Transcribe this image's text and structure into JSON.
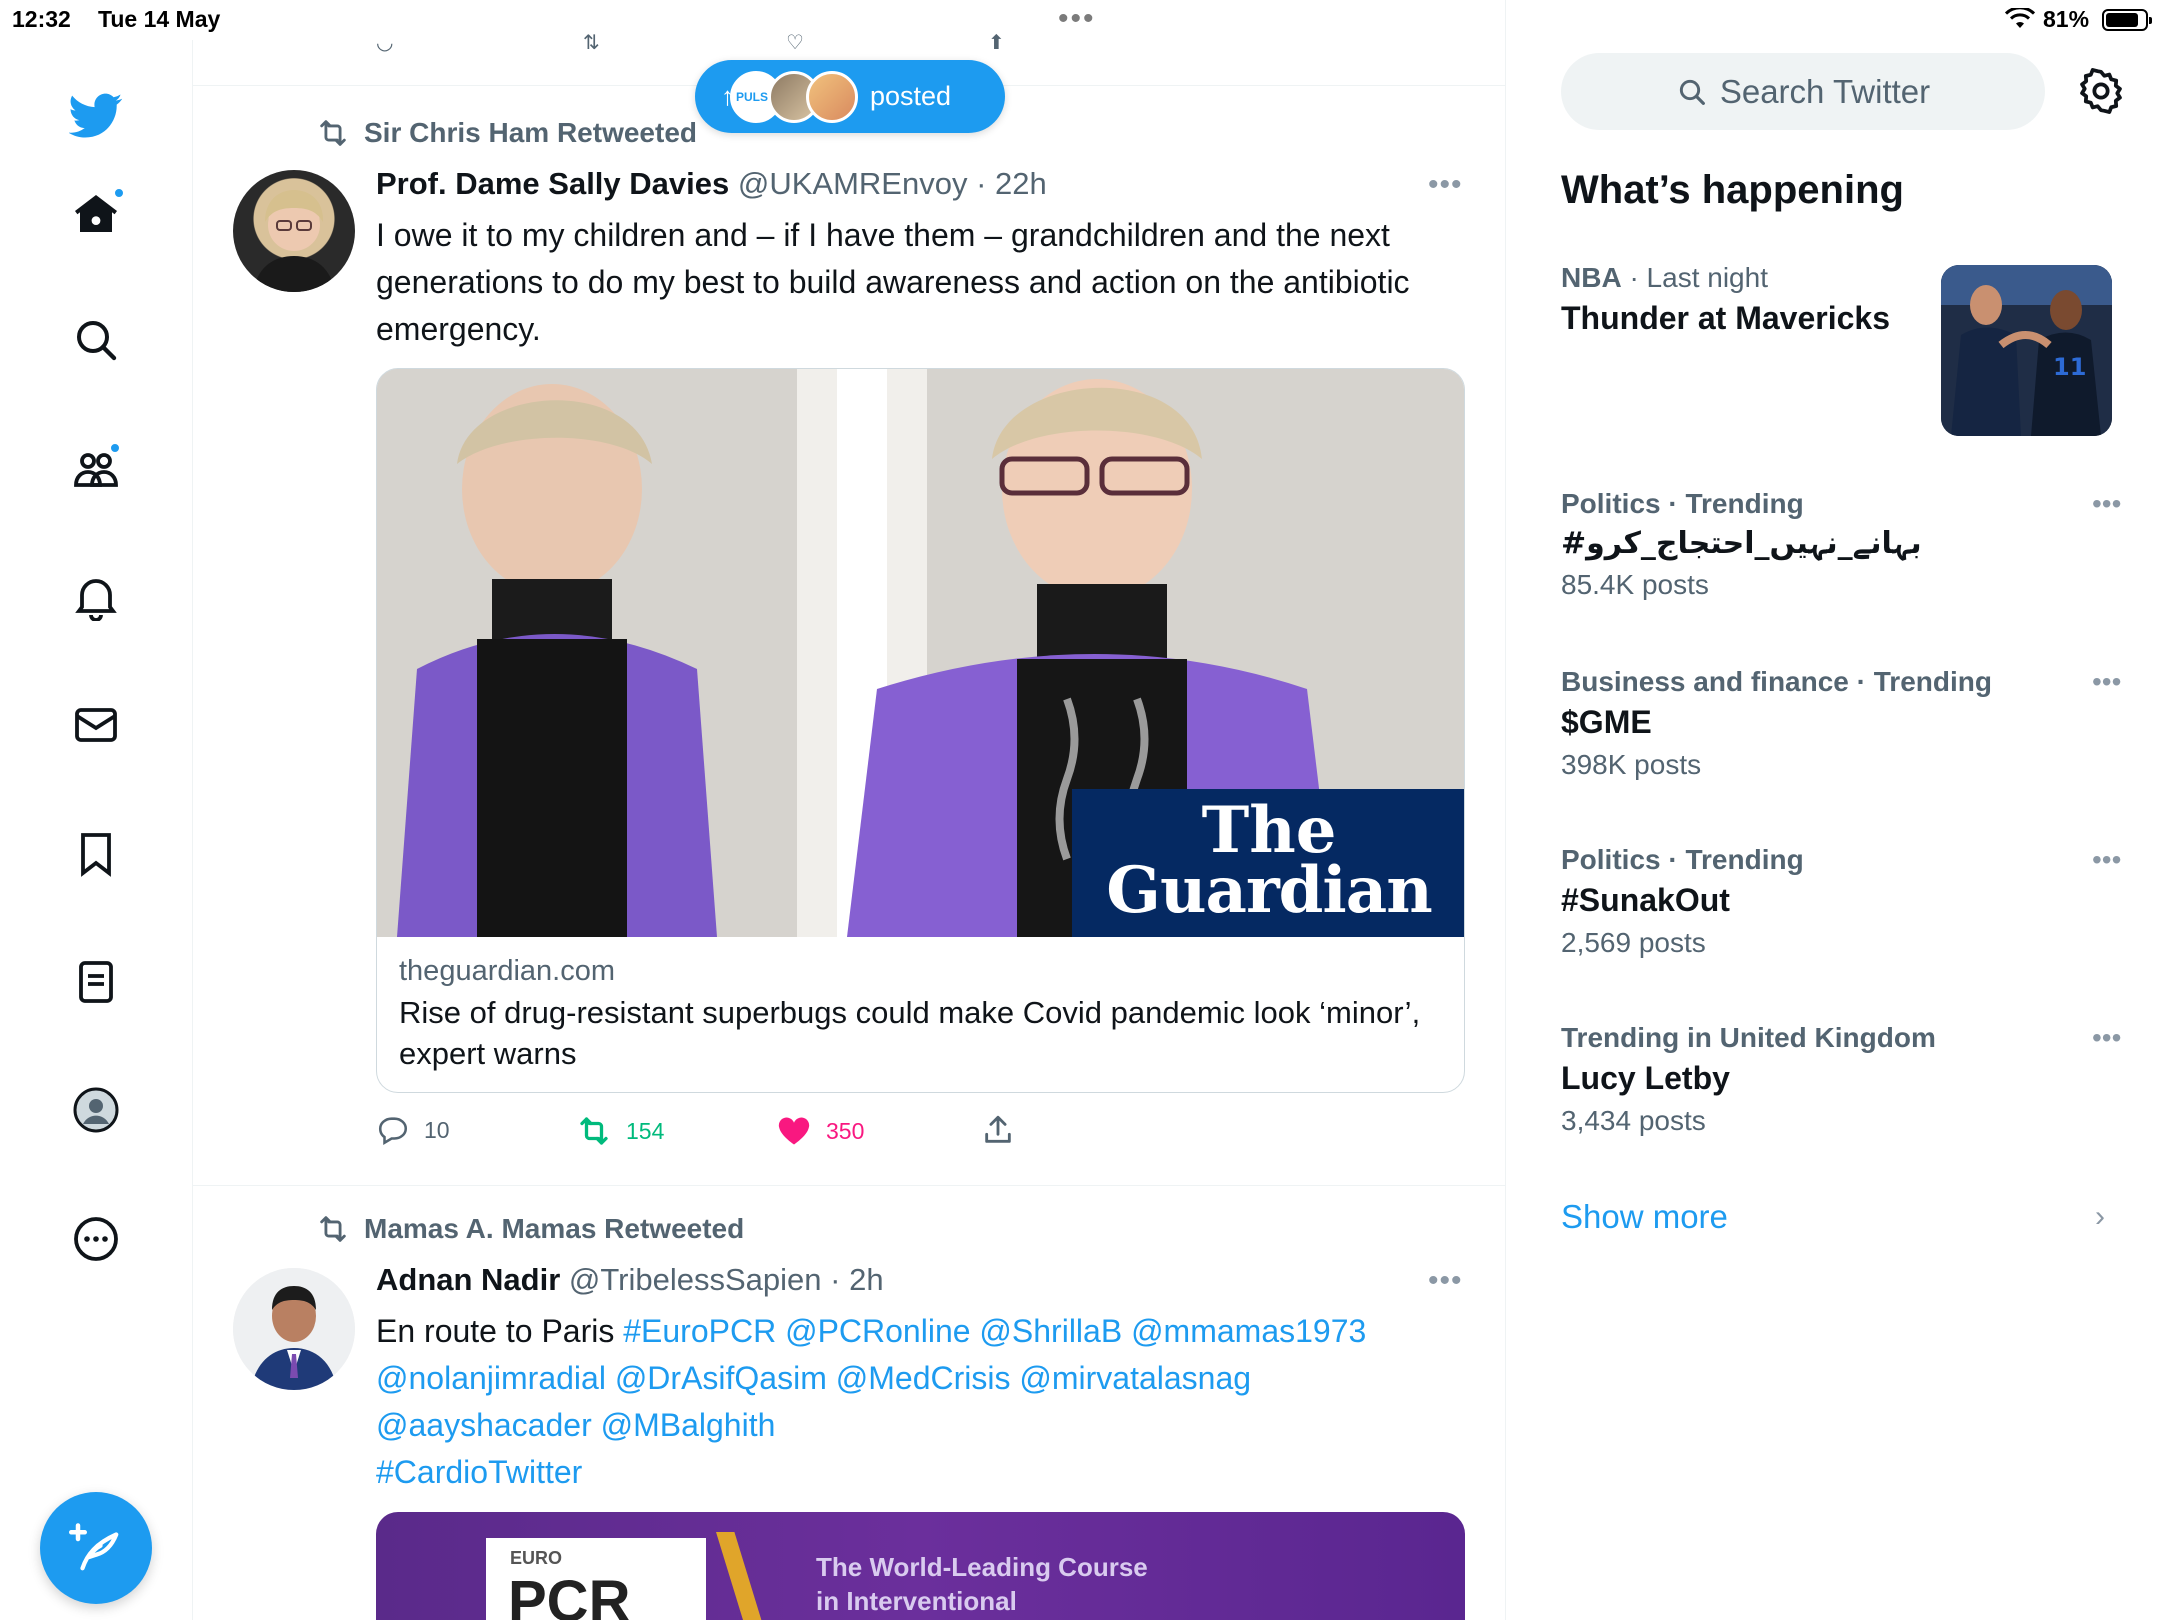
{
  "status_bar": {
    "time": "12:32",
    "date": "Tue 14 May",
    "battery": "81%",
    "battery_level": 0.81
  },
  "nav": {
    "items": [
      "home-icon",
      "search-icon",
      "communities-icon",
      "bell-icon",
      "mail-icon",
      "bookmark-icon",
      "lists-icon",
      "profile-icon",
      "more-icon"
    ]
  },
  "new_posts_pill": {
    "arrow": "↑",
    "label": "posted"
  },
  "tweets": [
    {
      "retweeted_by": "Sir Chris Ham Retweeted",
      "name": "Prof. Dame Sally Davies",
      "handle": "@UKAMREnvoy",
      "time": "· 22h",
      "text": "I owe it to my children and – if I have them – grandchildren and the next generations to do my best to build awareness and action on the antibiotic emergency.",
      "card": {
        "brand_line1": "The",
        "brand_line2": "Guardian",
        "domain": "theguardian.com",
        "title": "Rise of drug-resistant superbugs could make Covid pandemic look ‘minor’, expert warns"
      },
      "actions": {
        "replies": "10",
        "retweets": "154",
        "likes": "350"
      }
    },
    {
      "retweeted_by": "Mamas A. Mamas Retweeted",
      "name": "Adnan Nadir",
      "handle": "@TribelessSapien",
      "time": "· 2h",
      "text_plain": "En route to Paris",
      "links_line1": "#EuroPCR @PCRonline @ShrillaB @mmamas1973",
      "links_line2": "@nolanjimradial @DrAsifQasim @MedCrisis @mirvatalasnag",
      "links_line3": "@aayshacader @MBalghith",
      "links_line4": "#CardioTwitter",
      "media_text_1": "EURO",
      "media_text_2": "PCR",
      "media_text_3": "The World-Leading Course",
      "media_text_4": "in Interventional"
    }
  ],
  "sidebar": {
    "search_placeholder": "Search Twitter",
    "section_title": "What’s happening",
    "trends": [
      {
        "category": "NBA",
        "meta": " · Last night",
        "name": "Thunder at Mavericks",
        "count": ""
      },
      {
        "category": "Politics · Trending",
        "name": "#بہانے_نہیں_احتجاج_کرو",
        "count": "85.4K posts"
      },
      {
        "category": "Business and finance · Trending",
        "name": "$GME",
        "count": "398K posts"
      },
      {
        "category": "Politics · Trending",
        "name": "#SunakOut",
        "count": "2,569 posts"
      },
      {
        "category": "Trending in United Kingdom",
        "name": "Lucy Letby",
        "count": "3,434 posts"
      }
    ],
    "show_more": "Show more"
  },
  "colors": {
    "accent": "#1d9bf0",
    "retweet_green": "#00ba7c",
    "like_pink": "#f91880",
    "guardian_blue": "#052962",
    "secondary_text": "#536471"
  }
}
